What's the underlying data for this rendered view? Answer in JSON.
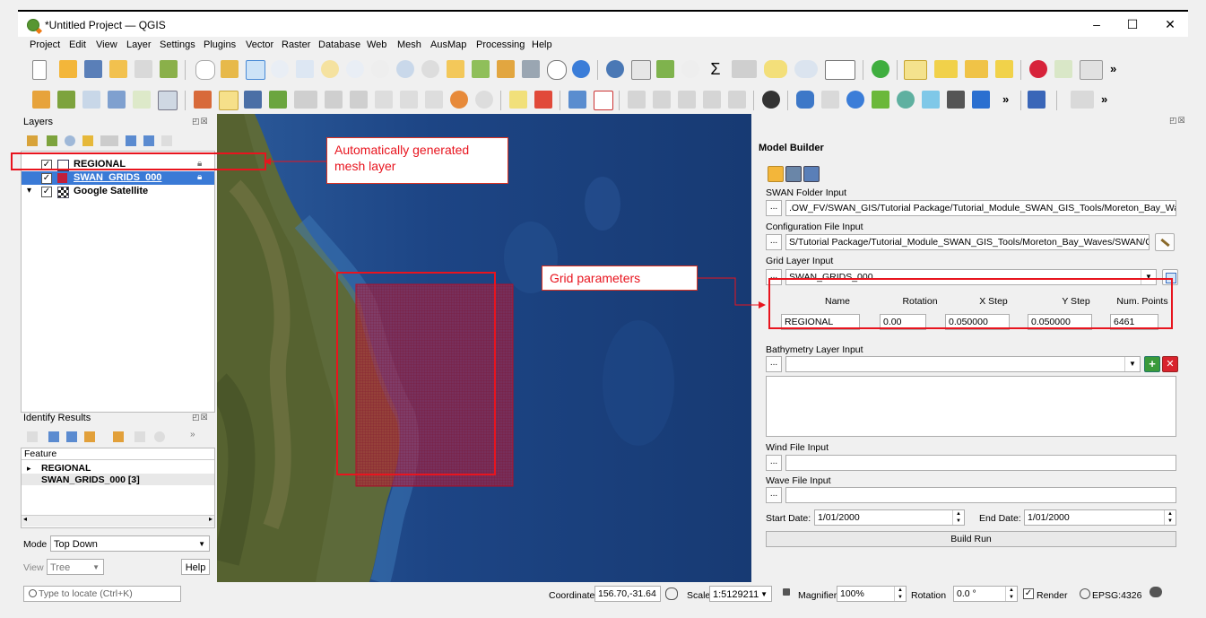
{
  "window": {
    "title": "*Untitled Project — QGIS",
    "minimize_label": "–",
    "maximize_label": "☐",
    "close_label": "✕"
  },
  "menu": [
    "Project",
    "Edit",
    "View",
    "Layer",
    "Settings",
    "Plugins",
    "Vector",
    "Raster",
    "Database",
    "Web",
    "Mesh",
    "AusMap",
    "Processing",
    "Help"
  ],
  "toolbar": {
    "overflow_label": "»"
  },
  "layers_panel": {
    "title": "Layers",
    "layers": [
      {
        "name": "REGIONAL",
        "checked": "✓"
      },
      {
        "name": "SWAN_GRIDS_000",
        "checked": "✓"
      },
      {
        "name": "Google Satellite",
        "checked": "✓"
      }
    ],
    "expand_glyph": "▾"
  },
  "identify_panel": {
    "title": "Identify Results",
    "feature_header": "Feature",
    "rows": [
      "REGIONAL",
      "SWAN_GRIDS_000  [3]"
    ],
    "mode_label": "Mode",
    "mode_value": "Top Down",
    "view_label": "View",
    "view_value": "Tree",
    "help_label": "Help"
  },
  "locator": {
    "placeholder": "Type to locate (Ctrl+K)"
  },
  "model_builder": {
    "title": "Model Builder",
    "swan_folder_label": "SWAN Folder Input",
    "swan_folder_value": ".OW_FV/SWAN_GIS/Tutorial Package/Tutorial_Module_SWAN_GIS_Tools/Moreton_Bay_Waves/SWAN",
    "config_label": "Configuration File Input",
    "config_value": "S/Tutorial Package/Tutorial_Module_SWAN_GIS_Tools/Moreton_Bay_Waves/SWAN/CONFIG.ini",
    "grid_layer_label": "Grid Layer Input",
    "grid_layer_value": "SWAN_GRIDS_000",
    "grid_headers": [
      "Name",
      "Rotation",
      "X Step",
      "Y Step",
      "Num. Points"
    ],
    "grid_values": [
      "REGIONAL",
      "0.00",
      "0.050000",
      "0.050000",
      "6461"
    ],
    "bathymetry_label": "Bathymetry Layer Input",
    "wind_label": "Wind File Input",
    "wave_label": "Wave File Input",
    "start_date_label": "Start Date:",
    "start_date_value": "1/01/2000",
    "end_date_label": "End Date:",
    "end_date_value": "1/01/2000",
    "build_run_label": "Build Run",
    "dots_label": "..."
  },
  "statusbar": {
    "coordinate_label": "Coordinate",
    "coordinate_value": "156.70,-31.64",
    "scale_label": "Scale",
    "scale_value": "1:5129211",
    "magnifier_label": "Magnifier",
    "magnifier_value": "100%",
    "rotation_label": "Rotation",
    "rotation_value": "0.0 °",
    "render_label": "Render",
    "render_checked": "✓",
    "crs_label": "EPSG:4326"
  },
  "annotations": {
    "mesh_callout": "Automatically generated mesh layer",
    "grid_callout": "Grid parameters"
  },
  "colors": {
    "accent_red": "#e8141e",
    "selection_blue": "#3a7ad6",
    "qgis_green": "#589632"
  }
}
